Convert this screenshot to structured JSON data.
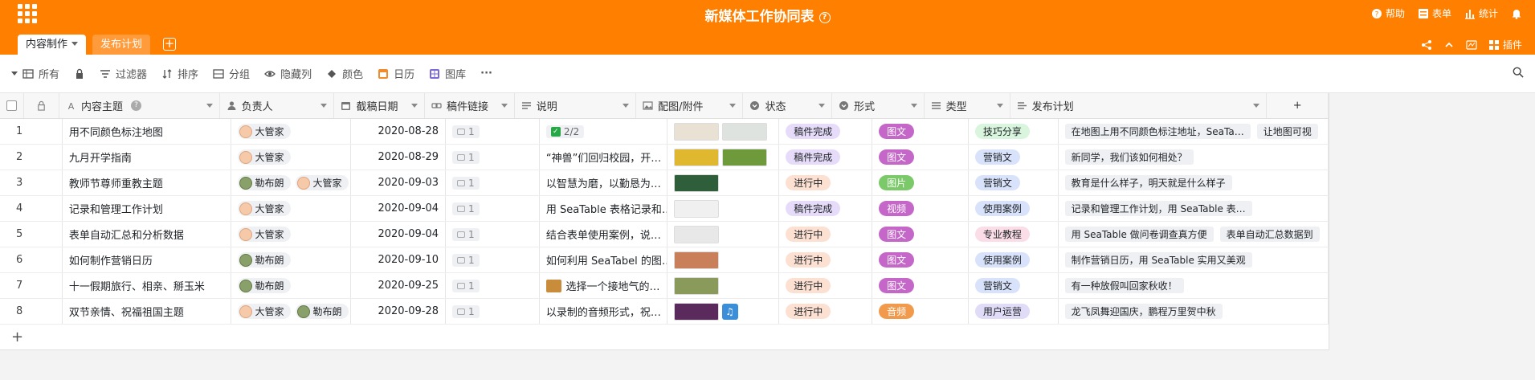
{
  "header": {
    "title": "新媒体工作协同表",
    "info_glyph": "?",
    "actions": [
      {
        "icon": "help-icon",
        "label": "帮助"
      },
      {
        "icon": "form-icon",
        "label": "表单"
      },
      {
        "icon": "statistics-icon",
        "label": "统计"
      },
      {
        "icon": "bell-icon",
        "label": ""
      }
    ],
    "tabs": [
      {
        "label": "内容制作",
        "active": true
      },
      {
        "label": "发布计划",
        "active": false
      }
    ],
    "add_tab_glyph": "+",
    "right_tools": [
      {
        "icon": "share-icon",
        "label": ""
      },
      {
        "icon": "collapse-icon",
        "label": ""
      },
      {
        "icon": "api-icon",
        "label": ""
      },
      {
        "icon": "plugin-icon",
        "label": "插件"
      }
    ]
  },
  "toolbar": {
    "view": "所有",
    "filter": "过滤器",
    "sort": "排序",
    "group": "分组",
    "hide": "隐藏列",
    "color": "颜色",
    "calendar": "日历",
    "gallery": "图库",
    "more": "···"
  },
  "columns": [
    {
      "key": "topic",
      "label": "内容主题",
      "icon": "text-icon"
    },
    {
      "key": "owner",
      "label": "负责人",
      "icon": "person-icon"
    },
    {
      "key": "date",
      "label": "截稿日期",
      "icon": "calendar-icon"
    },
    {
      "key": "link",
      "label": "稿件链接",
      "icon": "link-icon"
    },
    {
      "key": "desc",
      "label": "说明",
      "icon": "long-text-icon"
    },
    {
      "key": "att",
      "label": "配图/附件",
      "icon": "image-icon"
    },
    {
      "key": "status",
      "label": "状态",
      "icon": "single-select-icon"
    },
    {
      "key": "form",
      "label": "形式",
      "icon": "single-select-icon"
    },
    {
      "key": "type",
      "label": "类型",
      "icon": "multi-select-icon"
    },
    {
      "key": "plan",
      "label": "发布计划",
      "icon": "link-records-icon"
    }
  ],
  "add_column_glyph": "+",
  "add_row_glyph": "+",
  "rows": [
    {
      "num": "1",
      "topic": "用不同颜色标注地图",
      "owners": [
        {
          "name": "大管家",
          "avatar": "a"
        }
      ],
      "date": "2020-08-28",
      "link_count": "1",
      "desc": "2/2",
      "desc_type": "checklist",
      "attachments": [
        "#e9e2d4",
        "#dfe3e0"
      ],
      "status": "稿件完成",
      "status_color": "#e6dcfa",
      "form": "图文",
      "form_color": "#c566c9",
      "type": "技巧分享",
      "type_color": "#d9f5dd",
      "plan": [
        "在地图上用不同颜色标注地址，SeaTa…",
        "让地图可视"
      ]
    },
    {
      "num": "2",
      "topic": "九月开学指南",
      "owners": [
        {
          "name": "大管家",
          "avatar": "a"
        }
      ],
      "date": "2020-08-29",
      "link_count": "1",
      "desc": "“神兽”们回归校园，开…",
      "desc_type": "text",
      "attachments": [
        "#e0b830",
        "#6f9a3c"
      ],
      "status": "稿件完成",
      "status_color": "#e6dcfa",
      "form": "图文",
      "form_color": "#c566c9",
      "type": "营销文",
      "type_color": "#d8e2fa",
      "plan": [
        "新同学，我们该如何相处？"
      ]
    },
    {
      "num": "3",
      "topic": "教师节尊师重教主题",
      "owners": [
        {
          "name": "勒布朗",
          "avatar": "b"
        },
        {
          "name": "大管家",
          "avatar": "a"
        }
      ],
      "date": "2020-09-03",
      "link_count": "1",
      "desc": "以智慧为磨，以勤恳为…",
      "desc_type": "text",
      "attachments": [
        "#2f5e3a"
      ],
      "status": "进行中",
      "status_color": "#fce0d2",
      "form": "图片",
      "form_color": "#7cc96a",
      "type": "营销文",
      "type_color": "#d8e2fa",
      "plan": [
        "教育是什么样子，明天就是什么样子"
      ]
    },
    {
      "num": "4",
      "topic": "记录和管理工作计划",
      "owners": [
        {
          "name": "大管家",
          "avatar": "a"
        }
      ],
      "date": "2020-09-04",
      "link_count": "1",
      "desc": "用 SeaTable 表格记录和…",
      "desc_type": "text",
      "attachments": [
        "#f0f0f0"
      ],
      "status": "稿件完成",
      "status_color": "#e6dcfa",
      "form": "视频",
      "form_color": "#c566c9",
      "type": "使用案例",
      "type_color": "#d8e2fa",
      "plan": [
        "记录和管理工作计划，用 SeaTable 表…"
      ]
    },
    {
      "num": "5",
      "topic": "表单自动汇总和分析数据",
      "owners": [
        {
          "name": "大管家",
          "avatar": "a"
        }
      ],
      "date": "2020-09-04",
      "link_count": "1",
      "desc": "结合表单使用案例，说…",
      "desc_type": "text",
      "attachments": [
        "#e8e8e8"
      ],
      "status": "进行中",
      "status_color": "#fce0d2",
      "form": "图文",
      "form_color": "#c566c9",
      "type": "专业教程",
      "type_color": "#fadde6",
      "plan": [
        "用 SeaTable 做问卷调查真方便",
        "表单自动汇总数据到"
      ]
    },
    {
      "num": "6",
      "topic": "如何制作营销日历",
      "owners": [
        {
          "name": "勒布朗",
          "avatar": "b"
        }
      ],
      "date": "2020-09-10",
      "link_count": "1",
      "desc": "如何利用 SeaTabel 的图…",
      "desc_type": "text",
      "attachments": [
        "#c97f5a"
      ],
      "status": "进行中",
      "status_color": "#fce0d2",
      "form": "图文",
      "form_color": "#c566c9",
      "type": "使用案例",
      "type_color": "#d8e2fa",
      "plan": [
        "制作营销日历，用 SeaTable 实用又美观"
      ]
    },
    {
      "num": "7",
      "topic": "十一假期旅行、相亲、掰玉米",
      "owners": [
        {
          "name": "勒布朗",
          "avatar": "b"
        }
      ],
      "date": "2020-09-25",
      "link_count": "1",
      "desc": "选择一个接地气的…",
      "desc_type": "text-image",
      "attachments": [
        "#8a9a5a"
      ],
      "status": "进行中",
      "status_color": "#fce0d2",
      "form": "图文",
      "form_color": "#c566c9",
      "type": "营销文",
      "type_color": "#d8e2fa",
      "plan": [
        "有一种放假叫回家秋收！"
      ]
    },
    {
      "num": "8",
      "topic": "双节亲情、祝福祖国主题",
      "owners": [
        {
          "name": "大管家",
          "avatar": "a"
        },
        {
          "name": "勒布朗",
          "avatar": "b"
        }
      ],
      "date": "2020-09-28",
      "link_count": "1",
      "desc": "以录制的音频形式，祝…",
      "desc_type": "text",
      "attachments": [
        "#5b2a5c"
      ],
      "attachment_note": "♫",
      "status": "进行中",
      "status_color": "#fce0d2",
      "form": "音频",
      "form_color": "#f19a4c",
      "type": "用户运营",
      "type_color": "#e0dcf7",
      "plan": [
        "龙飞凤舞迎国庆，鹏程万里贺中秋"
      ]
    }
  ]
}
